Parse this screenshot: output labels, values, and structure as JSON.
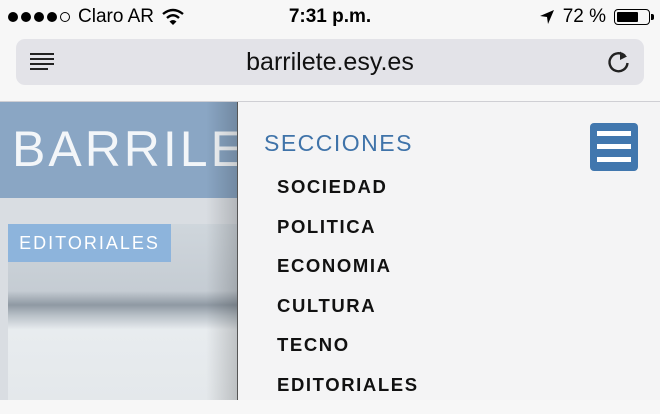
{
  "status_bar": {
    "carrier": "Claro AR",
    "time": "7:31 p.m.",
    "battery_text": "72 %",
    "battery_level": 0.72,
    "signal_bars_filled": 4,
    "signal_bars_total": 5
  },
  "browser": {
    "url": "barrilete.esy.es",
    "reader_icon": "reader-view-icon",
    "reload_icon": "reload-icon"
  },
  "page": {
    "logo": "BARRILE",
    "badge": "EDITORIALES",
    "header_color": "#8aa6c4",
    "badge_color": "#8db4dc"
  },
  "menu": {
    "title": "SECCIONES",
    "items": [
      "SOCIEDAD",
      "POLITICA",
      "ECONOMIA",
      "CULTURA",
      "TECNO",
      "EDITORIALES"
    ],
    "accent_color": "#3f73a9",
    "toggle_icon": "hamburger-menu-icon"
  }
}
